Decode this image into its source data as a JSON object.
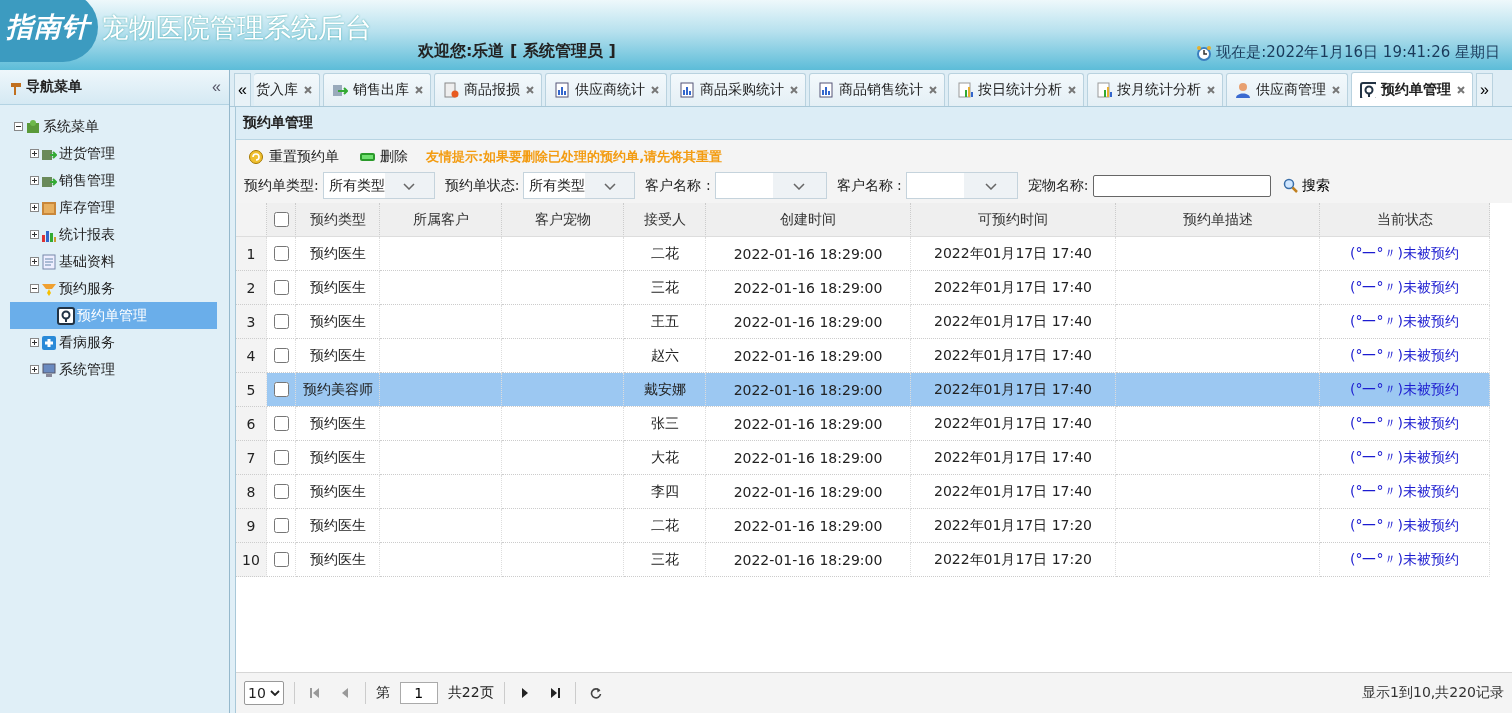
{
  "header": {
    "logo": "指南针",
    "title": "宠物医院管理系统后台",
    "welcome": "欢迎您:乐道 [ 系统管理员 ]",
    "clock": "现在是:2022年1月16日 19:41:26 星期日"
  },
  "sidebar": {
    "title": "导航菜单",
    "collapse": "«",
    "tree": [
      {
        "label": "系统菜单",
        "expanded": true,
        "selected": false,
        "children": [
          {
            "label": "进货管理",
            "expanded": false,
            "selected": false
          },
          {
            "label": "销售管理",
            "expanded": false,
            "selected": false
          },
          {
            "label": "库存管理",
            "expanded": false,
            "selected": false
          },
          {
            "label": "统计报表",
            "expanded": false,
            "selected": false
          },
          {
            "label": "基础资料",
            "expanded": false,
            "selected": false
          },
          {
            "label": "预约服务",
            "expanded": true,
            "selected": false,
            "children": [
              {
                "label": "预约单管理",
                "selected": true
              }
            ]
          },
          {
            "label": "看病服务",
            "expanded": false,
            "selected": false
          },
          {
            "label": "系统管理",
            "expanded": false,
            "selected": false
          }
        ]
      }
    ]
  },
  "tabs": {
    "scroll_left": "«",
    "scroll_right": "»",
    "items": [
      {
        "label": "货入库",
        "selected": false
      },
      {
        "label": "销售出库",
        "selected": false
      },
      {
        "label": "商品报损",
        "selected": false
      },
      {
        "label": "供应商统计",
        "selected": false
      },
      {
        "label": "商品采购统计",
        "selected": false
      },
      {
        "label": "商品销售统计",
        "selected": false
      },
      {
        "label": "按日统计分析",
        "selected": false
      },
      {
        "label": "按月统计分析",
        "selected": false
      },
      {
        "label": "供应商管理",
        "selected": false
      },
      {
        "label": "预约单管理",
        "selected": true
      }
    ]
  },
  "panel": {
    "title": "预约单管理",
    "toolbar": {
      "buttons": [
        "重置预约单",
        "删除"
      ],
      "tip": "友情提示:如果要删除已处理的预约单,请先将其重置"
    },
    "filters": [
      {
        "label": "预约单类型:",
        "kind": "select",
        "value": "所有类型"
      },
      {
        "label": "预约单状态:",
        "kind": "select",
        "value": "所有类型"
      },
      {
        "label": "客户名称 :",
        "kind": "select"
      },
      {
        "label": "客户名称 :",
        "kind": "select"
      },
      {
        "label": "宠物名称:",
        "kind": "input"
      }
    ],
    "search": "搜索",
    "table": {
      "all_checked": false,
      "columns": [
        "预约类型",
        "所属客户",
        "客户宠物",
        "接受人",
        "创建时间",
        "可预约时间",
        "预约单描述",
        "当前状态"
      ],
      "rows": [
        {
          "num": "1",
          "checked": false,
          "selected": false,
          "type": "预约医生",
          "receiver": "二花",
          "created": "2022-01-16 18:29:00",
          "bookable": "2022年01月17日 17:40",
          "status": "(°一°〃)未被预约"
        },
        {
          "num": "2",
          "checked": false,
          "selected": false,
          "type": "预约医生",
          "receiver": "三花",
          "created": "2022-01-16 18:29:00",
          "bookable": "2022年01月17日 17:40",
          "status": "(°一°〃)未被预约"
        },
        {
          "num": "3",
          "checked": false,
          "selected": false,
          "type": "预约医生",
          "receiver": "王五",
          "created": "2022-01-16 18:29:00",
          "bookable": "2022年01月17日 17:40",
          "status": "(°一°〃)未被预约"
        },
        {
          "num": "4",
          "checked": false,
          "selected": false,
          "type": "预约医生",
          "receiver": "赵六",
          "created": "2022-01-16 18:29:00",
          "bookable": "2022年01月17日 17:40",
          "status": "(°一°〃)未被预约"
        },
        {
          "num": "5",
          "checked": false,
          "selected": true,
          "type": "预约美容师",
          "receiver": "戴安娜",
          "created": "2022-01-16 18:29:00",
          "bookable": "2022年01月17日 17:40",
          "status": "(°一°〃)未被预约"
        },
        {
          "num": "6",
          "checked": false,
          "selected": false,
          "type": "预约医生",
          "receiver": "张三",
          "created": "2022-01-16 18:29:00",
          "bookable": "2022年01月17日 17:40",
          "status": "(°一°〃)未被预约"
        },
        {
          "num": "7",
          "checked": false,
          "selected": false,
          "type": "预约医生",
          "receiver": "大花",
          "created": "2022-01-16 18:29:00",
          "bookable": "2022年01月17日 17:40",
          "status": "(°一°〃)未被预约"
        },
        {
          "num": "8",
          "checked": false,
          "selected": false,
          "type": "预约医生",
          "receiver": "李四",
          "created": "2022-01-16 18:29:00",
          "bookable": "2022年01月17日 17:40",
          "status": "(°一°〃)未被预约"
        },
        {
          "num": "9",
          "checked": false,
          "selected": false,
          "type": "预约医生",
          "receiver": "二花",
          "created": "2022-01-16 18:29:00",
          "bookable": "2022年01月17日 17:20",
          "status": "(°一°〃)未被预约"
        },
        {
          "num": "10",
          "checked": false,
          "selected": false,
          "type": "预约医生",
          "receiver": "三花",
          "created": "2022-01-16 18:29:00",
          "bookable": "2022年01月17日 17:20",
          "status": "(°一°〃)未被预约"
        }
      ]
    },
    "pager": {
      "page_size": "10",
      "page_prefix": "第",
      "page": "1",
      "total": "共22页",
      "info": "显示1到10,共220记录"
    }
  }
}
